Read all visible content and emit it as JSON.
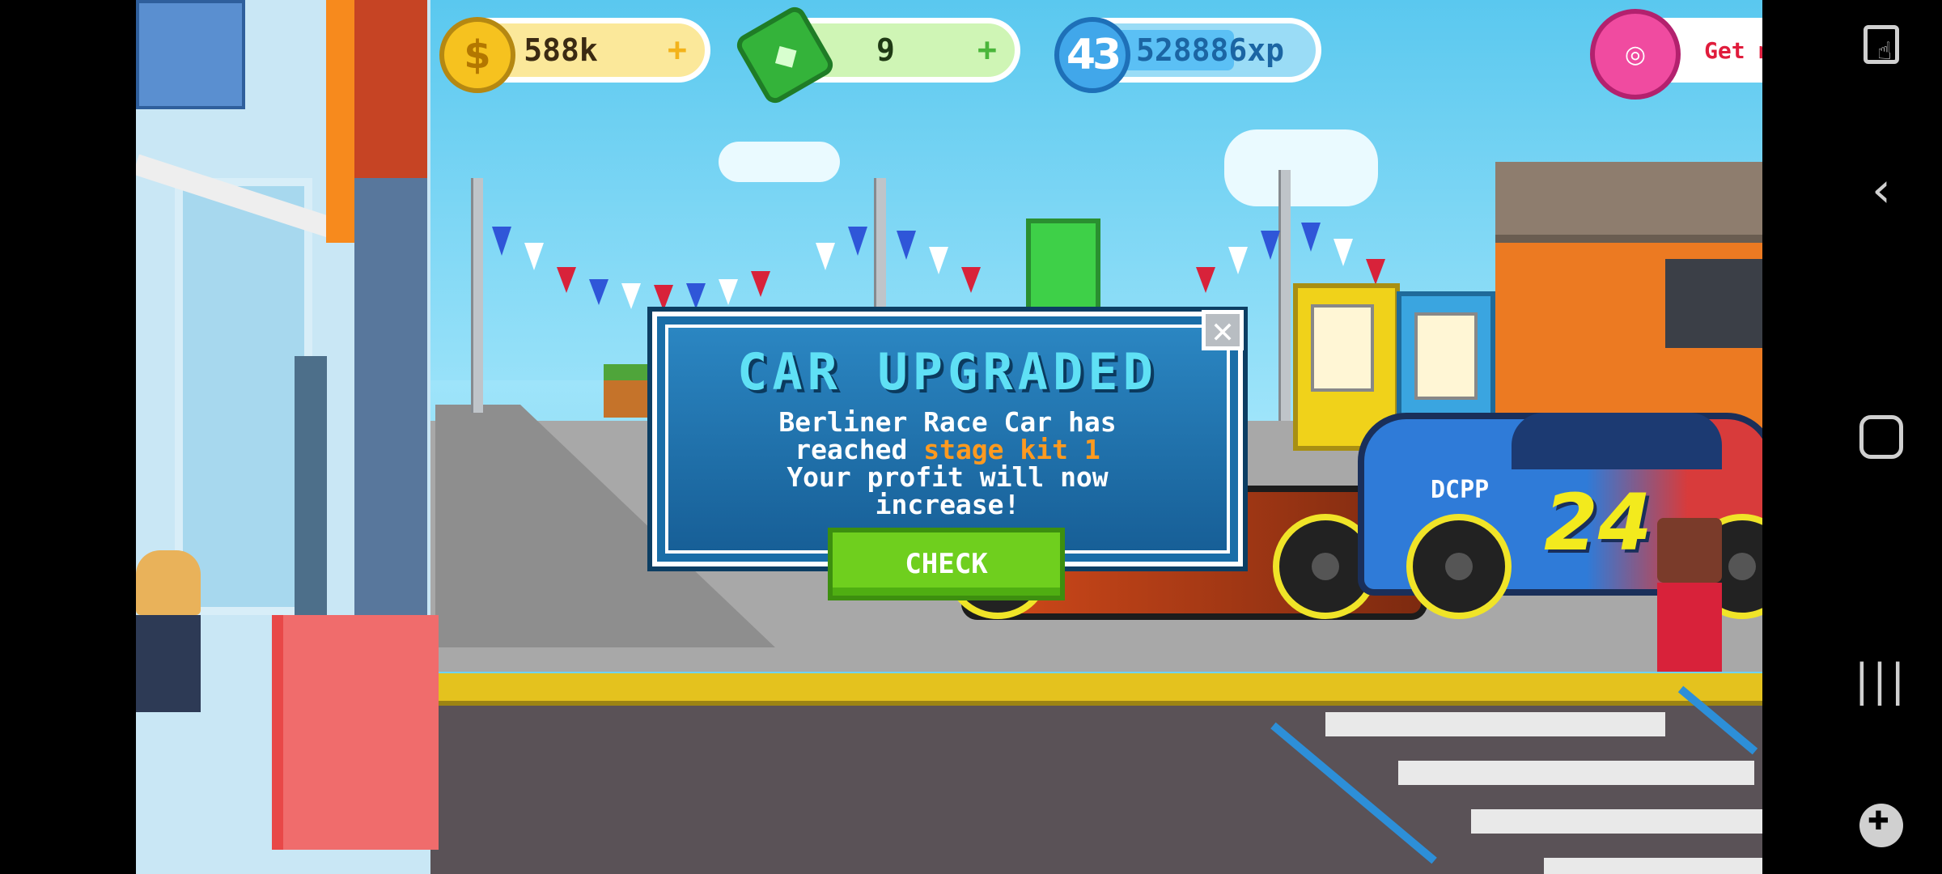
{
  "hud": {
    "coins": "588k",
    "cash": "9",
    "level": "43",
    "xp": "528886xp",
    "xp_progress": 0.6,
    "donut_action": "Get more"
  },
  "dialog": {
    "title": "CAR UPGRADED",
    "line1": "Berliner Race Car has",
    "line2_prefix": "reached",
    "line2_highlight": "stage kit 1",
    "line3": "Your profit will now",
    "line4": "increase!",
    "check_label": "CHECK",
    "close_label": "✕"
  },
  "scene": {
    "car_number": "24",
    "car_brand": "DCPP"
  },
  "nav": {
    "back": "‹",
    "recents": "|||"
  },
  "colors": {
    "dialog_bg": "#1a6ea8",
    "title": "#5fe0f5",
    "highlight": "#ff9a1f",
    "check": "#6fcf1e"
  }
}
